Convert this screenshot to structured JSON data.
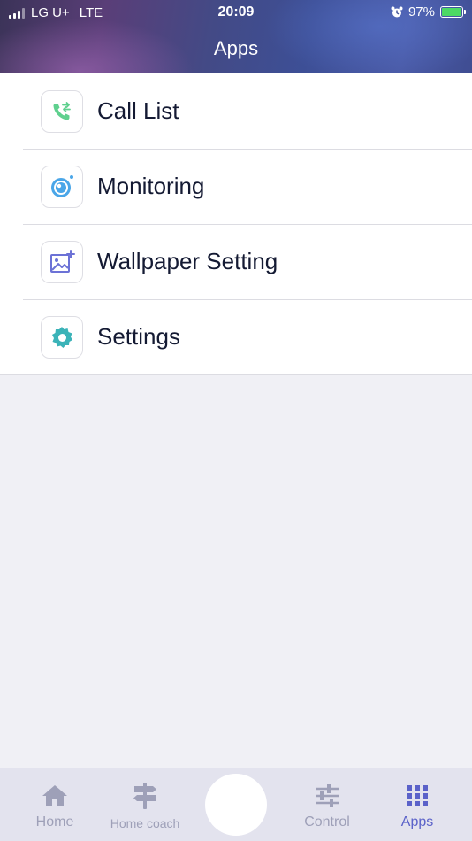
{
  "status_bar": {
    "carrier": "LG U+",
    "network": "LTE",
    "time": "20:09",
    "battery": "97%",
    "battery_color": "#4cd964"
  },
  "header": {
    "title": "Apps"
  },
  "apps": [
    {
      "label": "Call List",
      "icon": "phone-transfer-icon",
      "color": "#5fd08e"
    },
    {
      "label": "Monitoring",
      "icon": "camera-lens-icon",
      "color": "#4aa6e8"
    },
    {
      "label": "Wallpaper Setting",
      "icon": "image-add-icon",
      "color": "#6c72d6"
    },
    {
      "label": "Settings",
      "icon": "gear-icon",
      "color": "#3bb3b8"
    }
  ],
  "tabbar": {
    "active_color": "#5b62c9",
    "inactive_color": "#9ea0b8",
    "tabs": [
      {
        "label": "Home",
        "icon": "home-icon"
      },
      {
        "label": "Home coach",
        "icon": "signpost-icon"
      },
      {
        "label": "Control",
        "icon": "sliders-icon"
      },
      {
        "label": "Apps",
        "icon": "grid-icon",
        "active": true
      }
    ]
  }
}
